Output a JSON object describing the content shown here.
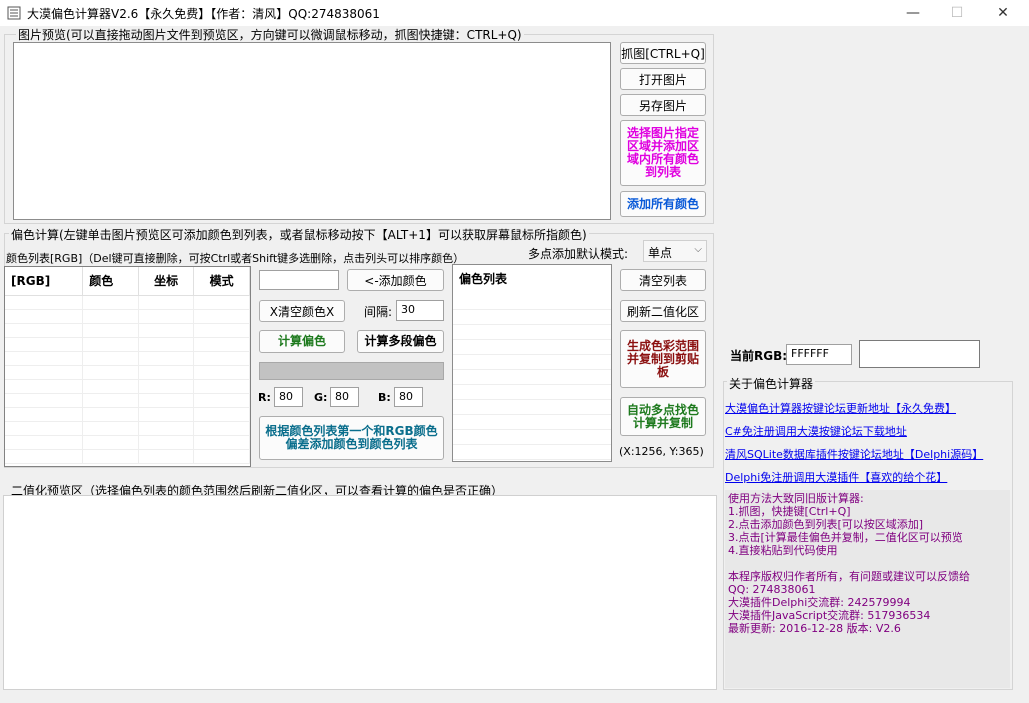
{
  "window": {
    "title": "大漠偏色计算器V2.6【永久免费】【作者：清风】QQ:274838061",
    "minimize": "—",
    "maximize": "☐",
    "close": "✕"
  },
  "preview": {
    "label": "图片预览(可以直接拖动图片文件到预览区，方向键可以微调鼠标移动，抓图快捷键：CTRL+Q)"
  },
  "preview_buttons": {
    "capture": "抓图[CTRL+Q]",
    "open": "打开图片",
    "save_as": "另存图片",
    "select_region": "选择图片指定区域并添加区域内所有颜色到列表",
    "add_all": "添加所有颜色"
  },
  "calc": {
    "label": "偏色计算(左键单击图片预览区可添加颜色到列表，或者鼠标移动按下【ALT+1】可以获取屏幕鼠标所指颜色)",
    "list_label": "颜色列表[RGB]（Del键可直接删除，可按Ctrl或者Shift键多选删除，点击列头可以排序颜色）",
    "multi_mode_label": "多点添加默认模式:",
    "multi_mode_value": "单点",
    "columns": [
      "[RGB]",
      "颜色",
      "坐标",
      "模式"
    ],
    "add_color": "<-添加颜色",
    "clear_color": "X清空颜色X",
    "interval_label": "间隔:",
    "interval_value": "30",
    "calc_offset": "计算偏色",
    "calc_multi": "计算多段偏色",
    "r_label": "R:",
    "r_value": "80",
    "g_label": "G:",
    "g_value": "80",
    "b_label": "B:",
    "b_value": "80",
    "add_by_rgb": "根据颜色列表第一个和RGB颜色偏差添加颜色到颜色列表",
    "offset_list_header": "偏色列表",
    "clear_list": "清空列表",
    "refresh_binary": "刷新二值化区",
    "gen_range": "生成色彩范围并复制到剪贴板",
    "auto_multi": "自动多点找色计算并复制",
    "coords": "(X:1256, Y:365)"
  },
  "current_rgb": {
    "label": "当前RGB:",
    "value": "FFFFFF"
  },
  "about": {
    "label": "关于偏色计算器",
    "links": [
      "大漠偏色计算器按键论坛更新地址【永久免费】",
      "C#免注册调用大漠按键论坛下载地址",
      "清风SQLite数据库插件按键论坛地址【Delphi源码】",
      "Delphi免注册调用大漠插件【喜欢的给个花】"
    ],
    "usage_lines": [
      "使用方法大致同旧版计算器:",
      "1.抓图，快捷键[Ctrl+Q]",
      "2.点击添加颜色到列表[可以按区域添加]",
      "3.点击[计算最佳偏色并复制，二值化区可以预览",
      "4.直接粘贴到代码使用",
      "",
      "本程序版权归作者所有，有问题或建议可以反馈给",
      "QQ: 274838061",
      "大漠插件Delphi交流群: 242579994",
      "大漠插件JavaScript交流群: 517936534",
      "最新更新: 2016-12-28 版本: V2.6"
    ]
  },
  "binary": {
    "label": "二值化预览区（选择偏色列表的颜色范围然后刷新二值化区，可以查看计算的偏色是否正确）"
  },
  "colors": {
    "magenta": "#e000e0",
    "blue_bold": "#0a5ad8",
    "green": "#1e7a1e",
    "darkred": "#8b1010",
    "teal": "#0a6e8c",
    "purple": "#800080",
    "link": "#0000ee"
  }
}
